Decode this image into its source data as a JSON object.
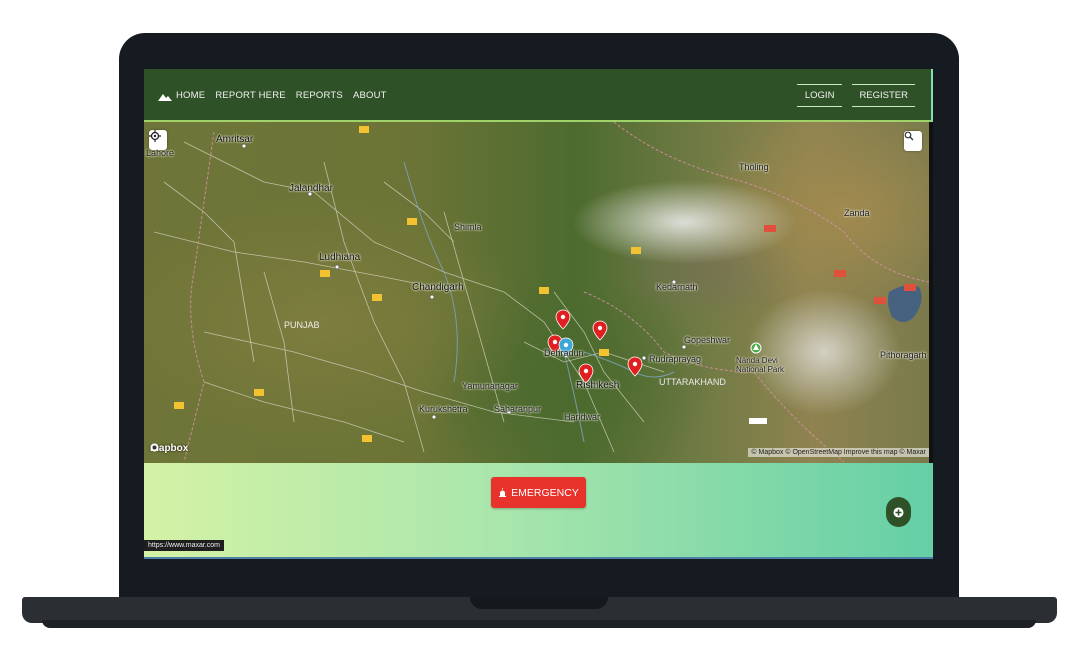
{
  "nav": {
    "home": "HOME",
    "report_here": "REPORT HERE",
    "reports": "REPORTS",
    "about": "ABOUT",
    "login": "LOGIN",
    "register": "REGISTER"
  },
  "map": {
    "labels": {
      "amritsar": "Amritsar",
      "lahore": "Lahore",
      "jalandhar": "Jalandhar",
      "ludhiana": "Ludhiana",
      "chandigarh": "Chandigarh",
      "punjab": "PUNJAB",
      "dehradun": "Dehradun",
      "rishikesh": "Rishikesh",
      "uttarakhand": "UTTARAKHAND",
      "saharanpur": "Saharanpur",
      "kurukshetra": "Kurukshetra",
      "haridwar": "Haridwar",
      "shimla": "Shimla",
      "yamunanagar": "Yamunanagar",
      "rudraprayag": "Rudraprayag",
      "gopeshwar": "Gopeshwar",
      "kedarnath": "Kedarnath",
      "nanda_devi": "Nanda Devi National Park",
      "pithoragarh": "Pithoragarh",
      "zanda": "Zanda",
      "tholing": "Thöling"
    },
    "mapbox_text": "mapbox",
    "attribution": "© Mapbox © OpenStreetMap  Improve this map © Maxar"
  },
  "emergency_label": "EMERGENCY",
  "status_url": "https://www.maxar.com",
  "colors": {
    "navbar": "#2f5127",
    "emergency": "#e8322c",
    "marker": "#e02020",
    "user_marker": "#3fa7d6"
  }
}
